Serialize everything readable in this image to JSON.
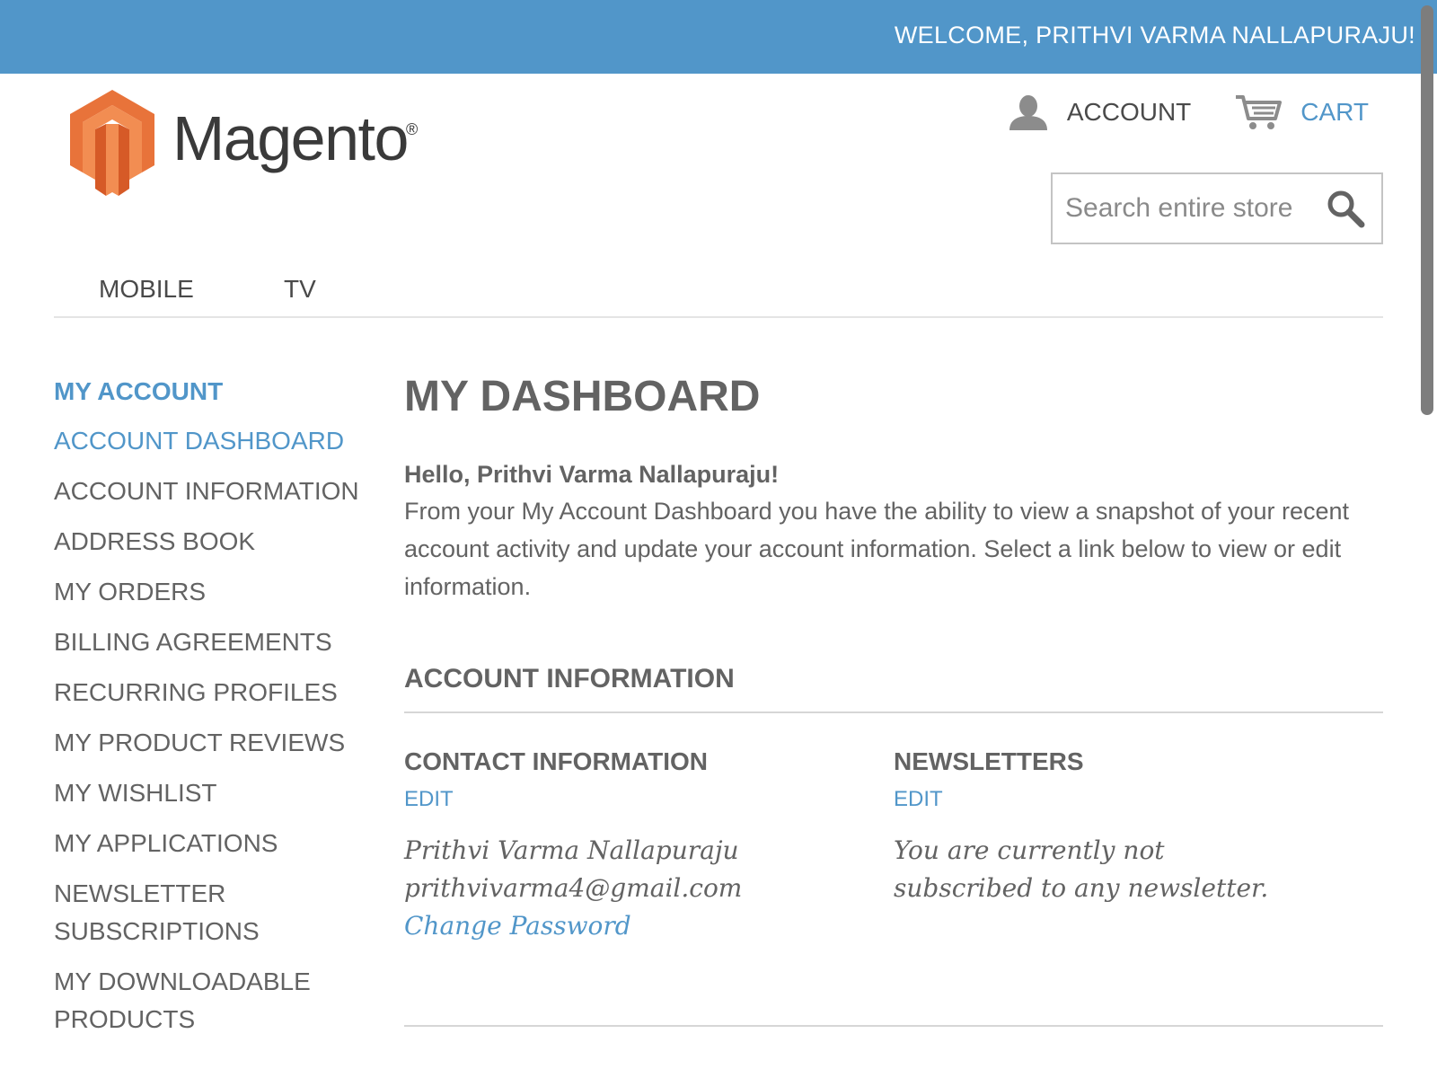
{
  "header": {
    "welcome": "WELCOME, PRITHVI VARMA NALLAPURAJU!",
    "logo_text": "Magento",
    "logo_reg": "®",
    "account_label": "ACCOUNT",
    "cart_label": "CART"
  },
  "search": {
    "placeholder": "Search entire store"
  },
  "nav": {
    "items": [
      "MOBILE",
      "TV"
    ]
  },
  "sidebar": {
    "title": "MY ACCOUNT",
    "items": [
      "ACCOUNT DASHBOARD",
      "ACCOUNT INFORMATION",
      "ADDRESS BOOK",
      "MY ORDERS",
      "BILLING AGREEMENTS",
      "RECURRING PROFILES",
      "MY PRODUCT REVIEWS",
      "MY WISHLIST",
      "MY APPLICATIONS",
      "NEWSLETTER SUBSCRIPTIONS",
      "MY DOWNLOADABLE PRODUCTS"
    ],
    "active_index": 0
  },
  "main": {
    "title": "MY DASHBOARD",
    "hello": "Hello, Prithvi Varma Nallapuraju!",
    "intro": "From your My Account Dashboard you have the ability to view a snapshot of your recent account activity and update your account information. Select a link below to view or edit information.",
    "section_title": "ACCOUNT INFORMATION",
    "contact": {
      "title": "CONTACT INFORMATION",
      "edit": "EDIT",
      "name": "Prithvi Varma Nallapuraju",
      "email": "prithvivarma4@gmail.com",
      "change_password": "Change Password"
    },
    "newsletters": {
      "title": "NEWSLETTERS",
      "edit": "EDIT",
      "status": "You are currently not subscribed to any newsletter."
    }
  },
  "colors": {
    "accent": "#5196c9",
    "text": "#636363",
    "logo_orange": "#e8733a"
  },
  "icons": [
    "user-icon",
    "cart-icon",
    "search-icon",
    "magento-logo-icon"
  ]
}
